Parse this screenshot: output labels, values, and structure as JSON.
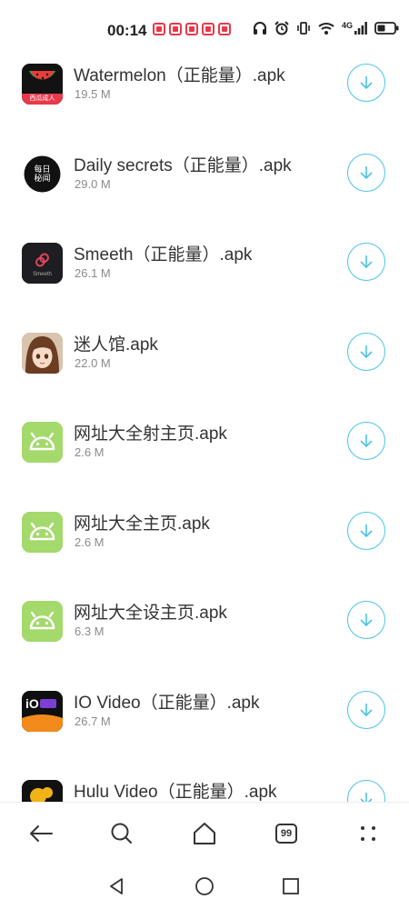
{
  "status_bar": {
    "time": "00:14",
    "network": "4G",
    "notification_icons": [
      "red-square-notification",
      "red-square-notification",
      "red-square-notification",
      "red-square-notification",
      "red-square-notification"
    ],
    "icons": [
      "headphones-icon",
      "alarm-icon",
      "vibrate-icon",
      "wifi-icon",
      "signal-icon",
      "battery-icon"
    ]
  },
  "downloads": [
    {
      "name": "Watermelon（正能量）.apk",
      "size": "19.5 M",
      "icon": "watermelon-app-icon",
      "icon_text": "西瓜成人"
    },
    {
      "name": "Daily secrets（正能量）.apk",
      "size": "29.0 M",
      "icon": "daily-secrets-app-icon",
      "icon_text": "每日秘闻"
    },
    {
      "name": "Smeeth（正能量）.apk",
      "size": "26.1 M",
      "icon": "smeeth-app-icon",
      "icon_text": "Smeeth"
    },
    {
      "name": "迷人馆.apk",
      "size": "22.0 M",
      "icon": "anime-girl-app-icon",
      "icon_text": ""
    },
    {
      "name": "网址大全射主页.apk",
      "size": "2.6 M",
      "icon": "android-app-icon",
      "icon_text": ""
    },
    {
      "name": "网址大全主页.apk",
      "size": "2.6 M",
      "icon": "android-app-icon",
      "icon_text": ""
    },
    {
      "name": "网址大全设主页.apk",
      "size": "6.3 M",
      "icon": "android-app-icon",
      "icon_text": ""
    },
    {
      "name": "IO Video（正能量）.apk",
      "size": "26.7 M",
      "icon": "io-video-app-icon",
      "icon_text": "iO"
    },
    {
      "name": "Hulu Video（正能量）.apk",
      "size": "",
      "icon": "hulu-video-app-icon",
      "icon_text": ""
    }
  ],
  "bottom_nav": {
    "tab_count": "99",
    "items": [
      "back-icon",
      "search-icon",
      "home-icon",
      "tabs-icon",
      "more-icon"
    ]
  },
  "colors": {
    "accent": "#4cc3e8",
    "notification_red": "#e8394b",
    "android_green": "#a4d96c",
    "size_text": "#8a8a8a"
  }
}
